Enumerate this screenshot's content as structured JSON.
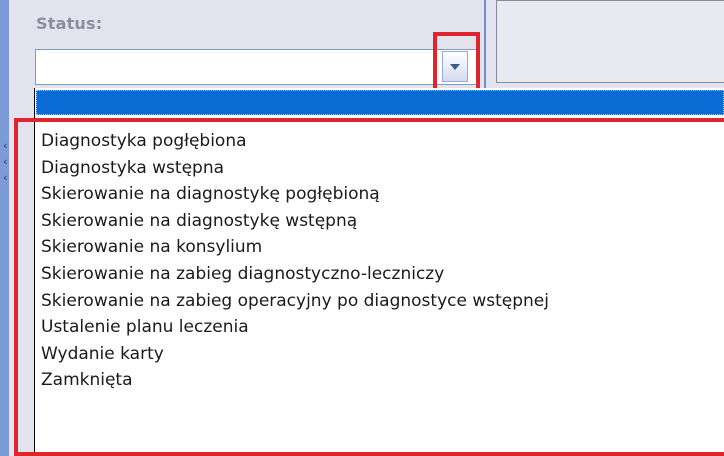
{
  "form": {
    "status_label": "Status:",
    "status_value": ""
  },
  "icons": {
    "dropdown_arrow": "chevron-down-icon"
  },
  "highlight_color": "#e0242b",
  "selection_color": "#0b6bd4",
  "dropdown": {
    "selected_item": "",
    "items": [
      "Diagnostyka pogłębiona",
      "Diagnostyka wstępna",
      "Skierowanie na diagnostykę pogłębioną",
      "Skierowanie na diagnostykę wstępną",
      "Skierowanie na konsylium",
      "Skierowanie na zabieg diagnostyczno-leczniczy",
      "Skierowanie na zabieg operacyjny po diagnostyce wstępnej",
      "Ustalenie planu leczenia",
      "Wydanie karty",
      "Zamknięta"
    ]
  }
}
